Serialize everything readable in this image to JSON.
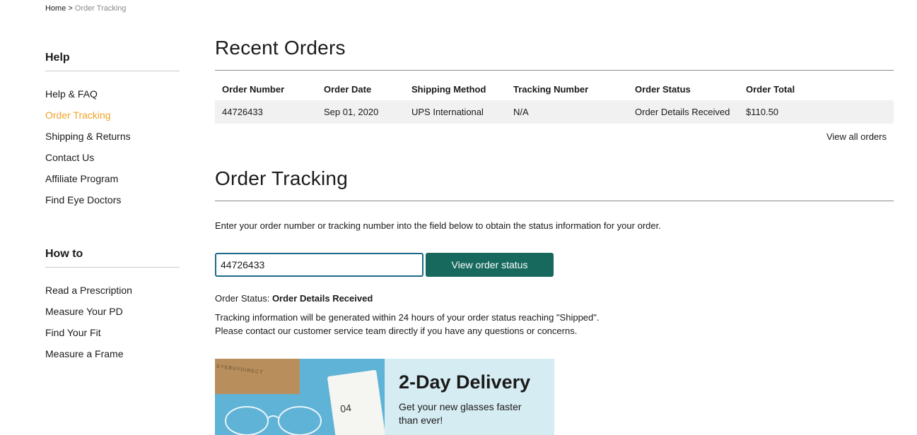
{
  "breadcrumb": {
    "home": "Home",
    "separator": ">",
    "current": "Order Tracking"
  },
  "sidebar": {
    "help_heading": "Help",
    "help_items": [
      {
        "label": "Help & FAQ"
      },
      {
        "label": "Order Tracking"
      },
      {
        "label": "Shipping & Returns"
      },
      {
        "label": "Contact Us"
      },
      {
        "label": "Affiliate Program"
      },
      {
        "label": "Find Eye Doctors"
      }
    ],
    "howto_heading": "How to",
    "howto_items": [
      {
        "label": "Read a Prescription"
      },
      {
        "label": "Measure Your PD"
      },
      {
        "label": "Find Your Fit"
      },
      {
        "label": "Measure a Frame"
      }
    ]
  },
  "recent_orders": {
    "title": "Recent Orders",
    "columns": [
      "Order Number",
      "Order Date",
      "Shipping Method",
      "Tracking Number",
      "Order Status",
      "Order Total"
    ],
    "rows": [
      [
        "44726433",
        "Sep 01, 2020",
        "UPS International",
        "N/A",
        "Order Details Received",
        "$110.50"
      ]
    ],
    "view_all": "View all orders"
  },
  "order_tracking": {
    "title": "Order Tracking",
    "intro": "Enter your order number or tracking number into the field below to obtain the status information for your order.",
    "input_value": "44726433",
    "button_label": "View order status",
    "status_label": "Order Status:",
    "status_value": "Order Details Received",
    "info_line1": "Tracking information will be generated within 24 hours of your order status reaching \"Shipped\".",
    "info_line2": "Please contact our customer service team directly if you have any questions or concerns."
  },
  "promo": {
    "title": "2-Day Delivery",
    "subtitle": "Get your new glasses faster than ever!",
    "box_text": "EYEBUYDIRECT",
    "calendar_text": "04"
  },
  "colors": {
    "accent_orange": "#f0a32a",
    "button_teal": "#17695e",
    "input_border": "#1c6a8a",
    "promo_bg": "#d6ecf3"
  }
}
